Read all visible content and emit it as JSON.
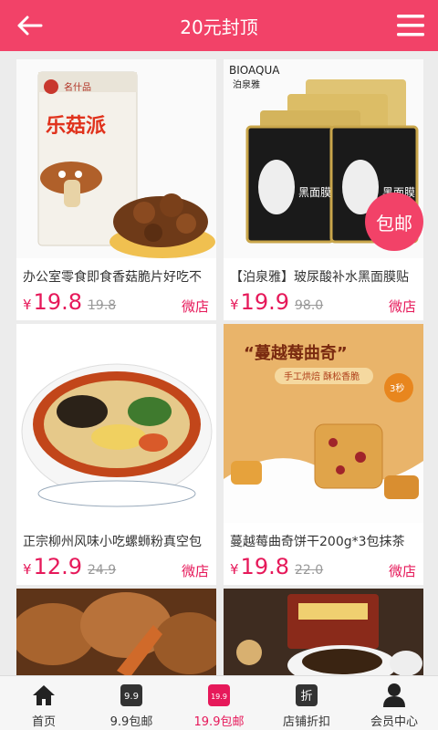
{
  "header": {
    "title": "20元封顶"
  },
  "colors": {
    "brand": "#f24268",
    "price": "#e6195a"
  },
  "products": [
    {
      "name": "办公室零食即食香菇脆片好吃不",
      "currency": "¥",
      "price": "19.8",
      "original_price": "19.8",
      "shop_label": "微店",
      "package_text": "乐菇派",
      "brand_text": "名什品"
    },
    {
      "name": "【泊泉雅】玻尿酸补水黑面膜贴",
      "currency": "¥",
      "price": "19.9",
      "original_price": "98.0",
      "shop_label": "微店",
      "badge": "包邮",
      "brand_text": "BIOAQUA",
      "brand_cn": "泊泉雅",
      "mask_text": "黑面膜"
    },
    {
      "name": "正宗柳州风味小吃螺蛳粉真空包",
      "currency": "¥",
      "price": "12.9",
      "original_price": "24.9",
      "shop_label": "微店"
    },
    {
      "name": "蔓越莓曲奇饼干200g*3包抹茶",
      "currency": "¥",
      "price": "19.8",
      "original_price": "22.0",
      "shop_label": "微店",
      "promo_title": "“蔓越莓曲奇”",
      "promo_sub": "手工烘焙 酥松香脆",
      "promo_badge": "3秒"
    }
  ],
  "tabbar": [
    {
      "label": "首页",
      "icon": "home-icon"
    },
    {
      "label": "9.9包邮",
      "icon": "nine-nine-icon",
      "icon_text": "9.9"
    },
    {
      "label": "19.9包邮",
      "icon": "nineteen-nine-icon",
      "icon_text": "19.9",
      "active": true
    },
    {
      "label": "店铺折扣",
      "icon": "discount-icon",
      "icon_text": "折"
    },
    {
      "label": "会员中心",
      "icon": "member-icon"
    }
  ]
}
